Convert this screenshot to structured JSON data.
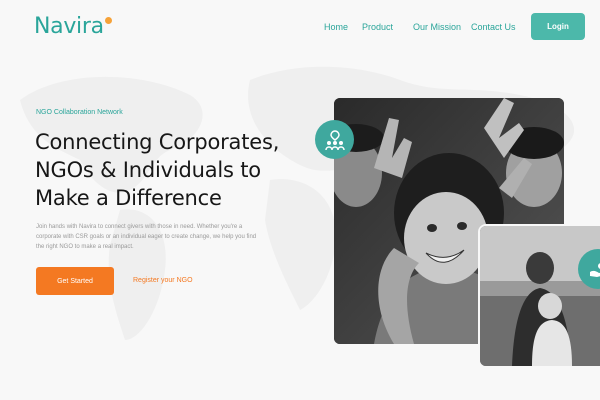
{
  "brand": {
    "name": "Navira",
    "accent": "#2aa59a",
    "dot_color": "#f6a238"
  },
  "nav": {
    "items": [
      {
        "label": "Home"
      },
      {
        "label": "Product"
      },
      {
        "label": "Our Mission"
      },
      {
        "label": "Contact Us"
      }
    ],
    "login_label": "Login"
  },
  "hero": {
    "eyebrow": "NGO Collaboration Network",
    "headline_lines": [
      "Connecting Corporates,",
      "NGOs & Individuals to",
      "Make a Difference"
    ],
    "description_lines": [
      "Join hands with Navira to connect givers with those in need. Whether you're a",
      "corporate with CSR goals or an individual eager to create change, we help you find",
      "the right NGO to make a real impact."
    ],
    "primary_cta": "Get Started",
    "secondary_cta": "Register your NGO",
    "cta_color": "#f47922"
  },
  "images": {
    "main_photo": "children-smiling-photo",
    "secondary_photo": "mother-and-child-photo",
    "badge_icon": "community-icon",
    "badge2_icon": "care-icon"
  }
}
